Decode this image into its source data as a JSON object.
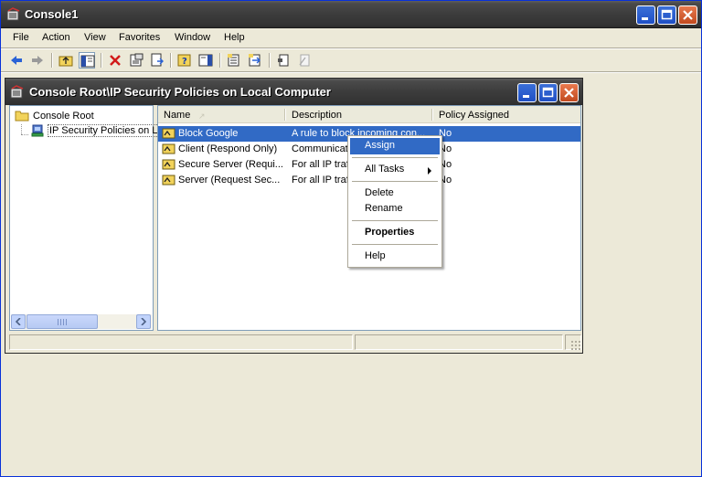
{
  "window": {
    "title": "Console1"
  },
  "menu": {
    "items": [
      "File",
      "Action",
      "View",
      "Favorites",
      "Window",
      "Help"
    ]
  },
  "toolbar": {
    "buttons": [
      "back-icon",
      "forward-icon",
      "up-one-level-icon",
      "show-hide-tree-icon",
      "delete-icon",
      "properties-icon",
      "export-list-icon",
      "help-icon",
      "show-hide-action-pane-icon",
      "manage-ip-filter-lists-icon",
      "manage-filter-actions-icon",
      "assign-icon",
      "unassign-icon"
    ]
  },
  "child_window": {
    "title": "Console Root\\IP Security Policies on Local Computer"
  },
  "tree": {
    "root": "Console Root",
    "child": "IP Security Policies on L"
  },
  "list": {
    "columns": [
      "Name",
      "Description",
      "Policy Assigned"
    ],
    "rows": [
      {
        "name": "Block Google",
        "description": "A rule to block incoming con...",
        "assigned": "No"
      },
      {
        "name": "Client (Respond Only)",
        "description": "Communicate",
        "assigned": "No"
      },
      {
        "name": "Secure Server (Requi...",
        "description": "For all IP traf",
        "assigned": "No"
      },
      {
        "name": "Server (Request Sec...",
        "description": "For all IP traf",
        "assigned": "No"
      }
    ]
  },
  "context_menu": {
    "assign": "Assign",
    "all_tasks": "All Tasks",
    "delete": "Delete",
    "rename": "Rename",
    "properties": "Properties",
    "help": "Help"
  },
  "colors": {
    "title_bar": "#3c3c3c",
    "selection": "#316ac5",
    "desktop": "#808080"
  }
}
